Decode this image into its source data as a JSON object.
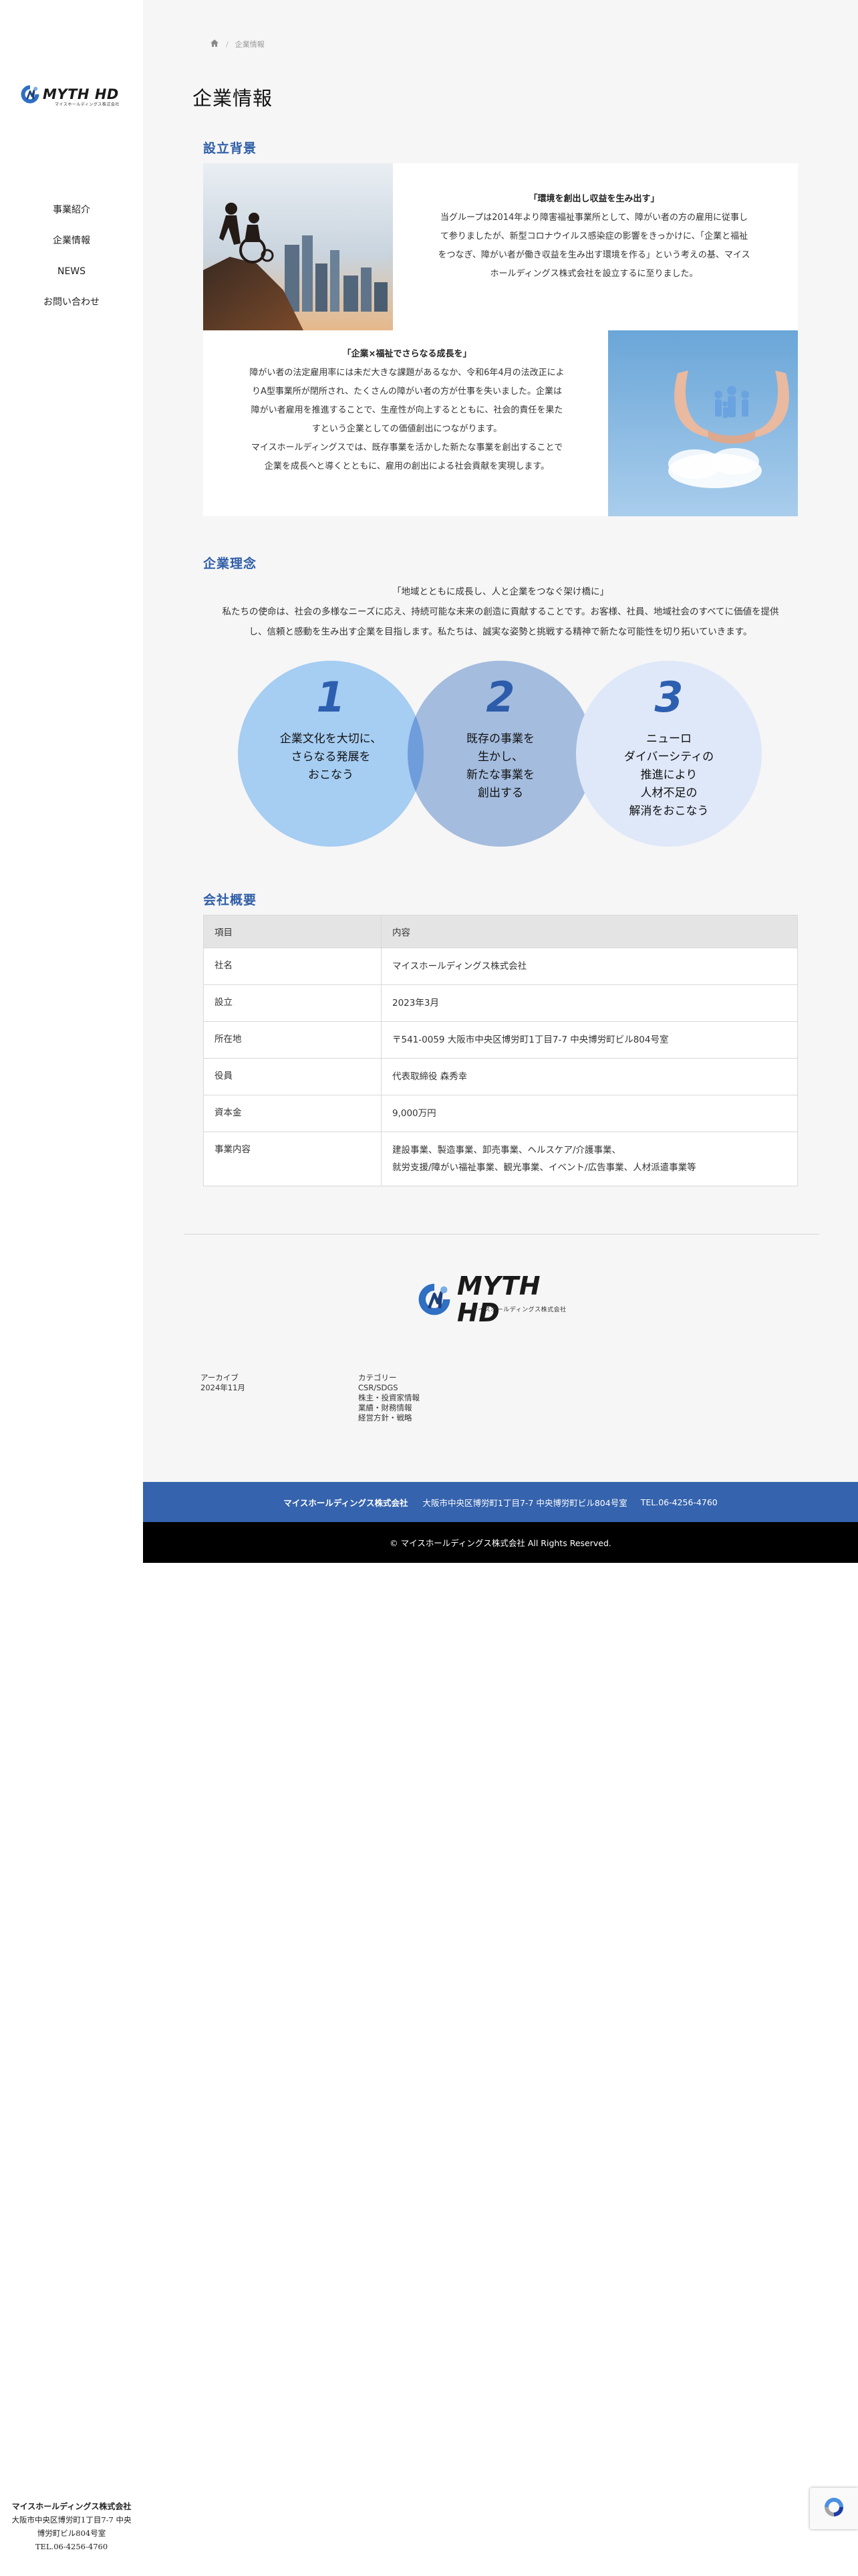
{
  "sidebar": {
    "logo_text": "MYTH HD",
    "logo_sub": "マイスホールディングス株式会社",
    "nav": [
      {
        "label": "事業紹介"
      },
      {
        "label": "企業情報"
      },
      {
        "label": "NEWS"
      },
      {
        "label": "お問い合わせ"
      }
    ],
    "footer": {
      "company": "マイスホールディングス株式会社",
      "address_line1": "大阪市中央区博労町1丁目7-7 中央",
      "address_line2": "博労町ビル804号室",
      "tel": "TEL.06-4256-4760"
    }
  },
  "breadcrumb": {
    "home_icon": "home-icon",
    "current": "企業情報"
  },
  "page_title": "企業情報",
  "background_section": {
    "title": "設立背景",
    "block1": {
      "heading": "「環境を創出し収益を生み出す」",
      "lines": [
        "当グループは2014年より障害福祉事業所として、障がい者の方の雇用に従事し",
        "て参りましたが、新型コロナウイルス感染症の影響をきっかけに、「企業と福祉",
        "をつなぎ、障がい者が働き収益を生み出す環境を作る」という考えの基、マイス",
        "ホールディングス株式会社を設立するに至りました。"
      ]
    },
    "block2": {
      "heading": "「企業×福祉でさらなる成長を」",
      "lines": [
        "障がい者の法定雇用率には未だ大きな課題があるなか、令和6年4月の法改正によ",
        "りA型事業所が閉所され、たくさんの障がい者の方が仕事を失いました。企業は",
        "障がい者雇用を推進することで、生産性が向上するとともに、社会的責任を果た",
        "すという企業としての価値創出につながります。",
        "マイスホールディングスでは、既存事業を活かした新たな事業を創出することで",
        "企業を成長へと導くとともに、雇用の創出による社会貢献を実現します。"
      ]
    }
  },
  "philosophy_section": {
    "title": "企業理念",
    "slogan": "「地域とともに成長し、人と企業をつなぐ架け橋に」",
    "lines": [
      "私たちの使命は、社会の多様なニーズに応え、持続可能な未来の創造に貢献することです。お客様、社員、地域社会のすべてに価値を提供",
      "し、信頼と感動を生み出す企業を目指します。私たちは、誠実な姿勢と挑戦する精神で新たな可能性を切り拓いていきます。"
    ],
    "circles": [
      {
        "num": "1",
        "text": "企業文化を大切に、\nさらなる発展を\nおこなう",
        "color": "#a6cdf2"
      },
      {
        "num": "2",
        "text": "既存の事業を\n生かし、\n新たな事業を\n創出する",
        "color": "#aac3e7"
      },
      {
        "num": "3",
        "text": "ニューロ\nダイバーシティの\n推進により\n人材不足の\n解消をおこなう",
        "color": "#dfe8f8"
      }
    ]
  },
  "overview_section": {
    "title": "会社概要",
    "header": [
      "項目",
      "内容"
    ],
    "rows": [
      {
        "label": "社名",
        "value": [
          "マイスホールディングス株式会社"
        ]
      },
      {
        "label": "設立",
        "value": [
          "2023年3月"
        ]
      },
      {
        "label": "所在地",
        "value": [
          "〒541-0059 大阪市中央区博労町1丁目7-7 中央博労町ビル804号室"
        ]
      },
      {
        "label": "役員",
        "value": [
          "代表取締役 森秀幸"
        ]
      },
      {
        "label": "資本金",
        "value": [
          "9,000万円"
        ]
      },
      {
        "label": "事業内容",
        "value": [
          "建設事業、製造事業、卸売事業、ヘルスケア/介護事業、",
          "就労支援/障がい福祉事業、観光事業、イベント/広告事業、人材派遣事業等"
        ]
      }
    ]
  },
  "footer": {
    "logo_text": "MYTH HD",
    "logo_sub": "マイスホールディングス株式会社",
    "archive": {
      "heading": "アーカイブ",
      "items": [
        "2024年11月"
      ]
    },
    "category": {
      "heading": "カテゴリー",
      "items": [
        "CSR/SDGS",
        "株主・投資家情報",
        "業績・財務情報",
        "経営方針・戦略"
      ]
    },
    "bar": {
      "company": "マイスホールディングス株式会社",
      "address": "大阪市中央区博労町1丁目7-7 中央博労町ビル804号室",
      "tel": "TEL.06-4256-4760"
    },
    "copyright": "© マイスホールディングス株式会社 All Rights Reserved."
  },
  "colors": {
    "accent": "#2f5ea8",
    "footer_blue": "#3563ad",
    "main_bg": "#f6f6f6"
  },
  "icons": [
    "home-icon",
    "logo-mark-icon",
    "recaptcha-icon"
  ]
}
